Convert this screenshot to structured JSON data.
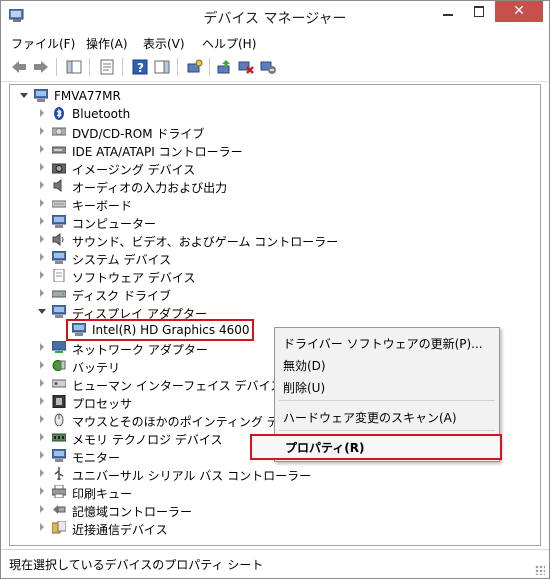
{
  "window": {
    "title": "デバイス マネージャー",
    "close_symbol": "✕"
  },
  "menu": [
    {
      "label": "ファイル(F)"
    },
    {
      "label": "操作(A)"
    },
    {
      "label": "表示(V)"
    },
    {
      "label": "ヘルプ(H)"
    }
  ],
  "tree": {
    "root": "FMVA77MR",
    "items": [
      {
        "label": "Bluetooth",
        "icon": "bluetooth-icon"
      },
      {
        "label": "DVD/CD-ROM ドライブ",
        "icon": "dvd-drive-icon"
      },
      {
        "label": "IDE ATA/ATAPI コントローラー",
        "icon": "ide-controller-icon"
      },
      {
        "label": "イメージング デバイス",
        "icon": "imaging-device-icon"
      },
      {
        "label": "オーディオの入力および出力",
        "icon": "audio-icon"
      },
      {
        "label": "キーボード",
        "icon": "keyboard-icon"
      },
      {
        "label": "コンピューター",
        "icon": "computer-icon"
      },
      {
        "label": "サウンド、ビデオ、およびゲーム コントローラー",
        "icon": "sound-icon"
      },
      {
        "label": "システム デバイス",
        "icon": "system-device-icon"
      },
      {
        "label": "ソフトウェア デバイス",
        "icon": "software-device-icon"
      },
      {
        "label": "ディスク ドライブ",
        "icon": "disk-drive-icon"
      },
      {
        "label": "ディスプレイ アダプター",
        "icon": "display-adapter-icon",
        "expanded": true
      },
      {
        "label": "Intel(R) HD Graphics 4600",
        "icon": "monitor-icon",
        "child": true
      },
      {
        "label": "ネットワーク アダプター",
        "icon": "network-adapter-icon"
      },
      {
        "label": "バッテリ",
        "icon": "battery-icon"
      },
      {
        "label": "ヒューマン インターフェイス デバイス",
        "icon": "hid-icon"
      },
      {
        "label": "プロセッサ",
        "icon": "processor-icon"
      },
      {
        "label": "マウスとそのほかのポインティング デバイス",
        "icon": "mouse-icon"
      },
      {
        "label": "メモリ テクノロジ デバイス",
        "icon": "memory-icon"
      },
      {
        "label": "モニター",
        "icon": "monitor-icon"
      },
      {
        "label": "ユニバーサル シリアル バス コントローラー",
        "icon": "usb-icon"
      },
      {
        "label": "印刷キュー",
        "icon": "printer-icon"
      },
      {
        "label": "記憶域コントローラー",
        "icon": "storage-controller-icon"
      },
      {
        "label": "近接通信デバイス",
        "icon": "proximity-icon"
      }
    ]
  },
  "context_menu": {
    "items": [
      {
        "label": "ドライバー ソフトウェアの更新(P)..."
      },
      {
        "label": "無効(D)"
      },
      {
        "label": "削除(U)"
      },
      {
        "label": "ハードウェア変更のスキャン(A)"
      },
      {
        "label": "プロパティ(R)"
      }
    ]
  },
  "status": {
    "text": "現在選択しているデバイスのプロパティ シート"
  },
  "colors": {
    "highlight_border": "#d4141c",
    "close_button": "#c7504b"
  }
}
